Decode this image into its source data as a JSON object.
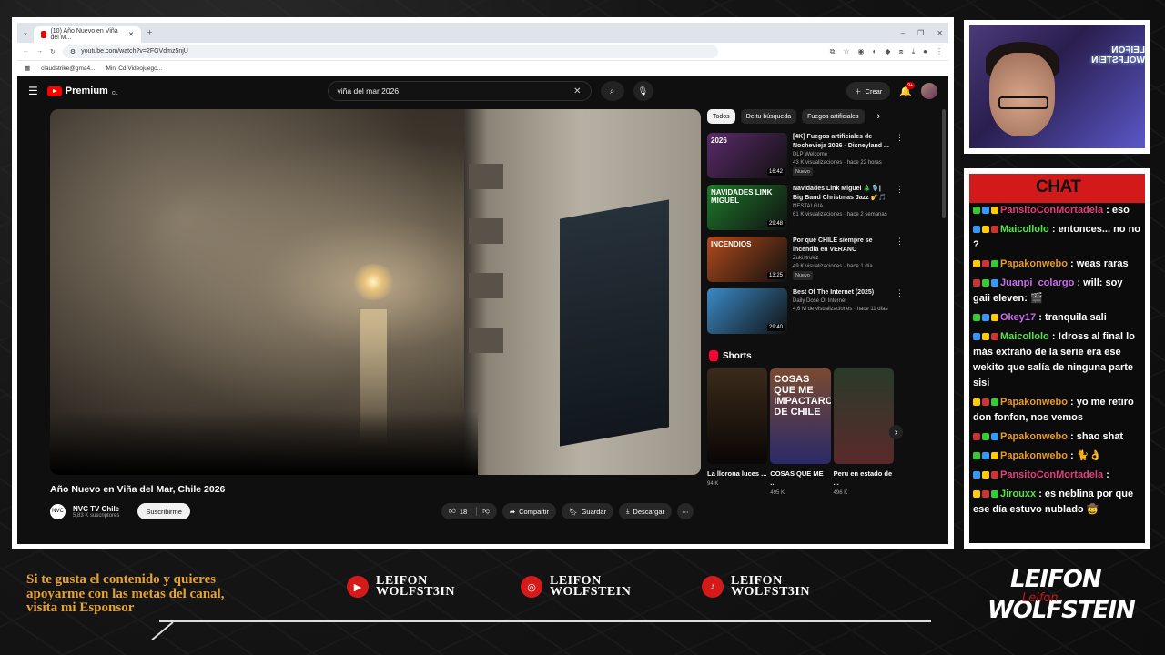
{
  "browser": {
    "tab_title": "(10) Año Nuevo en Viña del M...",
    "url": "youtube.com/watch?v=2FGVdmz5njU",
    "bookmarks": [
      "claudstrike@gma4...",
      "Mini Cd Videojuego..."
    ]
  },
  "youtube": {
    "logo": "Premium",
    "logo_sup": "CL",
    "search_value": "viña del mar 2026",
    "create_label": "Crear",
    "notif_count": "9+",
    "video_title": "Año Nuevo en Viña del Mar, Chile 2026",
    "channel_name": "NVC TV Chile",
    "channel_logo": "NVC",
    "subscribers": "5,83 K suscriptores",
    "subscribe_label": "Suscribirme",
    "likes": "18",
    "share_label": "Compartir",
    "save_label": "Guardar",
    "download_label": "Descargar",
    "chips": [
      "Todos",
      "De tu búsqueda",
      "Fuegos artificiales"
    ],
    "recommended": [
      {
        "title": "[4K] Fuegos artificiales de Nochevieja 2026 - Disneyland ...",
        "channel": "DLP Welcome",
        "meta": "43 K visualizaciones · hace 22 horas",
        "badge": "Nuevo",
        "duration": "16:42",
        "thumb_text": "2026",
        "color": "#5a2a6a"
      },
      {
        "title": "Navidades Link Miguel 🎄🎙️| Big Band Christmas Jazz 🎷🎵",
        "channel": "NESTALGIA",
        "meta": "61 K visualizaciones · hace 2 semanas",
        "badge": "",
        "duration": "29:48",
        "thumb_text": "NAVIDADES LINK MIGUEL",
        "color": "#1e7a2a"
      },
      {
        "title": "Por qué CHILE siempre se incendia en VERANO",
        "channel": "Zukistrukiz",
        "meta": "49 K visualizaciones · hace 1 día",
        "badge": "Nuevo",
        "duration": "13:25",
        "thumb_text": "INCENDIOS",
        "color": "#b24a1a"
      },
      {
        "title": "Best Of The Internet (2025)",
        "channel": "Daily Dose Of Internet",
        "meta": "4,6 M de visualizaciones · hace 11 días",
        "badge": "",
        "duration": "29:40",
        "thumb_text": "",
        "color": "#3a8ac8"
      }
    ],
    "shorts_label": "Shorts",
    "shorts": [
      {
        "title": "La llorona luces ...",
        "views": "94 K",
        "thumb_text": ""
      },
      {
        "title": "COSAS QUE ME ...",
        "views": "495 K",
        "thumb_text": "COSAS QUE ME IMPACTARON DE CHILE"
      },
      {
        "title": "Peru en estado de ...",
        "views": "496 K",
        "thumb_text": ""
      }
    ]
  },
  "cam": {
    "neon": "LEIFON WOLFSTEIN"
  },
  "chat": {
    "title": "CHAT",
    "messages": [
      {
        "user": "PansitoConMortadela",
        "color": "#e0407a",
        "text": ": eso"
      },
      {
        "user": "Maicollolo",
        "color": "#56e34a",
        "text": ": entonces... no no ?"
      },
      {
        "user": "Papakonwebo",
        "color": "#e89a25",
        "text": ": weas raras"
      },
      {
        "user": "Juanpi_colargo",
        "color": "#c86de8",
        "text": ": will: soy gaii eleven: 🎬"
      },
      {
        "user": "Okey17",
        "color": "#c86de8",
        "text": ": tranquila sali"
      },
      {
        "user": "Maicollolo",
        "color": "#56e34a",
        "text": ": !dross al final lo más extraño de la serie era ese wekito que salía de ninguna parte sisi"
      },
      {
        "user": "Papakonwebo",
        "color": "#e89a25",
        "text": ": yo me retiro don fonfon, nos vemos"
      },
      {
        "user": "Papakonwebo",
        "color": "#e89a25",
        "text": ": shao shat"
      },
      {
        "user": "Papakonwebo",
        "color": "#e89a25",
        "text": ": 🐈👌"
      },
      {
        "user": "PansitoConMortadela",
        "color": "#e0407a",
        "text": ":"
      },
      {
        "user": "Jirouxx",
        "color": "#56e34a",
        "text": ": es neblina por que ese día estuvo nublado 🤠"
      }
    ]
  },
  "footer": {
    "promo": "Si te gusta el contenido y quieres apoyarme con las metas del canal, visita mi Esponsor",
    "youtube_line1": "LEIFON",
    "youtube_line2": "WOLFST3IN",
    "instagram_line1": "LEIFON",
    "instagram_line2": "WOLFSTEIN",
    "tiktok_line1": "LEIFON",
    "tiktok_line2": "WOLFST3IN",
    "brand_top": "LEIFON",
    "brand_bottom": "WOLFSTEIN",
    "brand_script": "Leifon"
  }
}
